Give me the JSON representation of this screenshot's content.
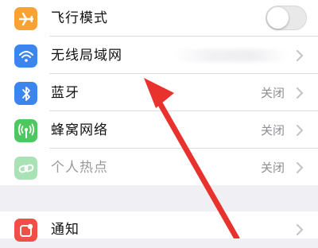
{
  "settings": {
    "rows": [
      {
        "label": "飞行模式",
        "value": "",
        "icon": "airplane-icon",
        "color": "#f7a233"
      },
      {
        "label": "无线局域网",
        "value": "",
        "icon": "wifi-icon",
        "color": "#3a86ee"
      },
      {
        "label": "蓝牙",
        "value": "关闭",
        "icon": "bluetooth-icon",
        "color": "#3a86ee"
      },
      {
        "label": "蜂窝网络",
        "value": "关闭",
        "icon": "antenna-icon",
        "color": "#4cc85f"
      },
      {
        "label": "个人热点",
        "value": "关闭",
        "icon": "link-icon",
        "color": "#a9e2b4"
      },
      {
        "label": "通知",
        "value": "",
        "icon": "notification-icon",
        "color": "#f04e47"
      }
    ],
    "airplane_mode_on": false
  },
  "annotation": {
    "color": "#e8322e",
    "icon": "red-arrow"
  }
}
